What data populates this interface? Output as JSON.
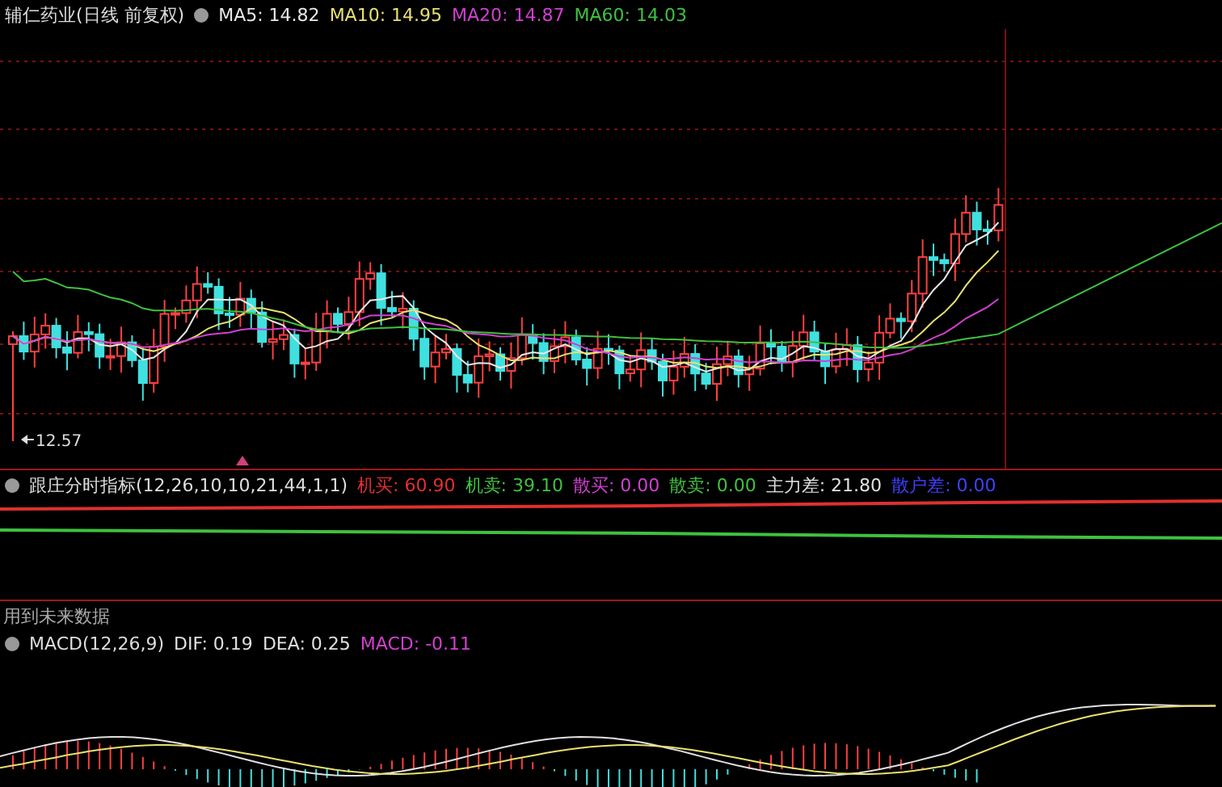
{
  "main_chart": {
    "title": "辅仁药业(日线 前复权)",
    "indicators": [
      {
        "label": "MA5: 14.82",
        "color": "#e8e8e8"
      },
      {
        "label": "MA10: 14.95",
        "color": "#e8e070"
      },
      {
        "label": "MA20: 14.87",
        "color": "#d040d0"
      },
      {
        "label": "MA60: 14.03",
        "color": "#40c040"
      }
    ],
    "low_marker": "12.57"
  },
  "indicator_panel": {
    "title": "跟庄分时指标(12,26,10,10,21,44,1,1)",
    "values": [
      {
        "label": "机买: 60.90",
        "color": "#e03030"
      },
      {
        "label": "机卖: 39.10",
        "color": "#40c040"
      },
      {
        "label": "散买: 0.00",
        "color": "#d040d0"
      },
      {
        "label": "散卖: 0.00",
        "color": "#40c040"
      },
      {
        "label": "主力差: 21.80",
        "color": "#e0e0e0"
      },
      {
        "label": "散户差: 0.00",
        "color": "#4040ff"
      }
    ]
  },
  "note": "用到未来数据",
  "macd_panel": {
    "title": "MACD(12,26,9)",
    "values": [
      {
        "label": "DIF: 0.19",
        "color": "#e0e0e0"
      },
      {
        "label": "DEA: 0.25",
        "color": "#e0e0e0"
      },
      {
        "label": "MACD: -0.11",
        "color": "#d040d0"
      }
    ]
  }
}
